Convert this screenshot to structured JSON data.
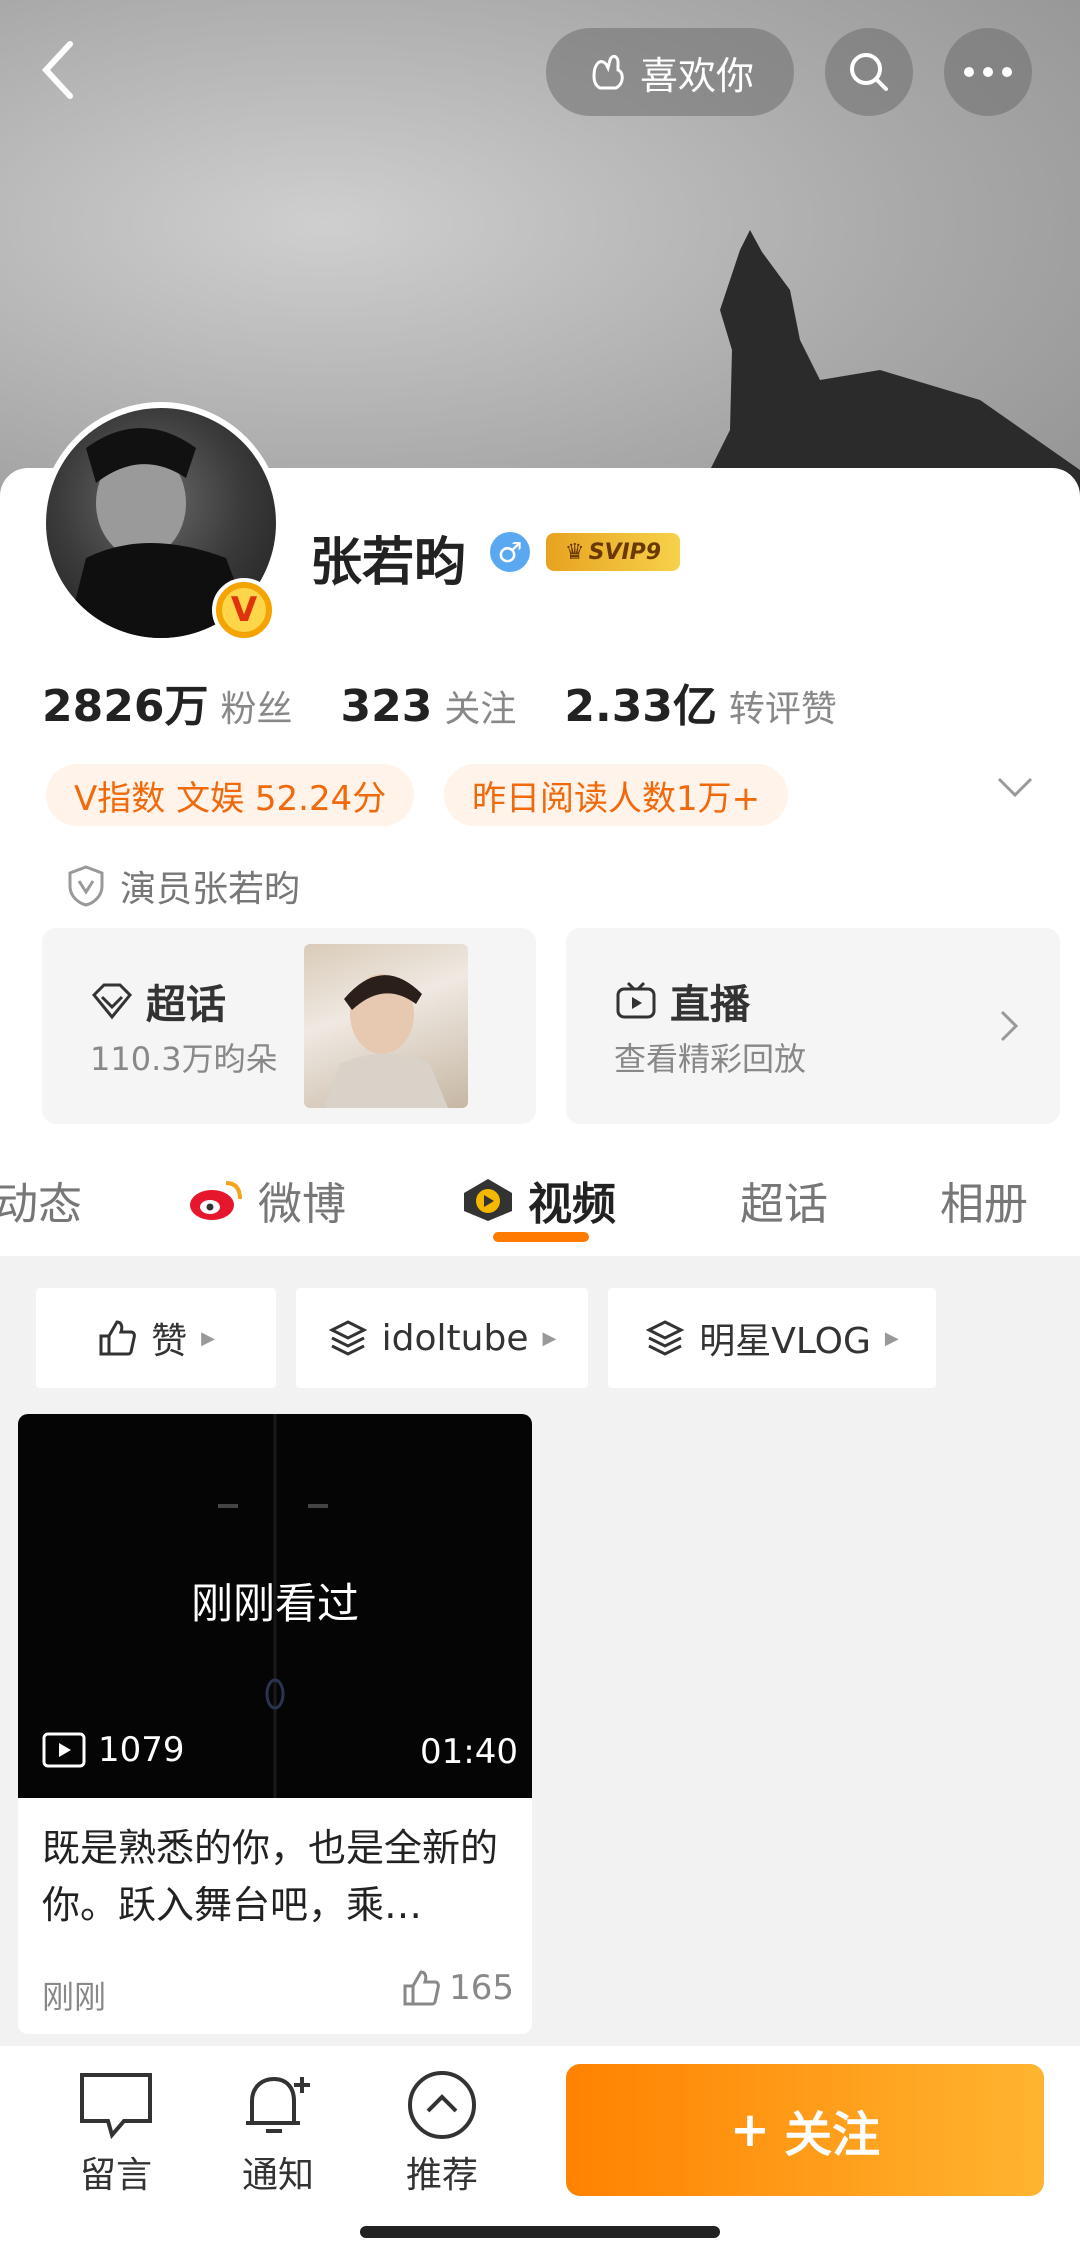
{
  "header": {
    "like_label": "喜欢你"
  },
  "profile": {
    "name": "张若昀",
    "svip": "SVIP9",
    "stats": [
      {
        "num": "2826万",
        "label": "粉丝"
      },
      {
        "num": "323",
        "label": "关注"
      },
      {
        "num": "2.33亿",
        "label": "转评赞"
      }
    ],
    "tags": [
      "V指数 文娱 52.24分",
      "昨日阅读人数1万+"
    ],
    "intro": "演员张若昀"
  },
  "boxes": {
    "chaohua": {
      "title": "超话",
      "sub": "110.3万昀朵"
    },
    "live": {
      "title": "直播",
      "sub": "查看精彩回放"
    }
  },
  "tabs": [
    "动态",
    "微博",
    "视频",
    "超话",
    "相册"
  ],
  "active_tab": "视频",
  "filters": [
    "赞",
    "idoltube",
    "明星VLOG"
  ],
  "video": {
    "overlay": "刚刚看过",
    "plays": "1079",
    "duration": "01:40",
    "title": "既是熟悉的你，也是全新的你。跃入舞台吧，乘…",
    "time": "刚刚",
    "likes": "165"
  },
  "bottom_bar": {
    "message": "留言",
    "notify": "通知",
    "recommend": "推荐",
    "follow": "关注"
  },
  "colors": {
    "accent": "#ff7a00",
    "tag_text": "#f0690a",
    "gender": "#5aa9f0"
  }
}
